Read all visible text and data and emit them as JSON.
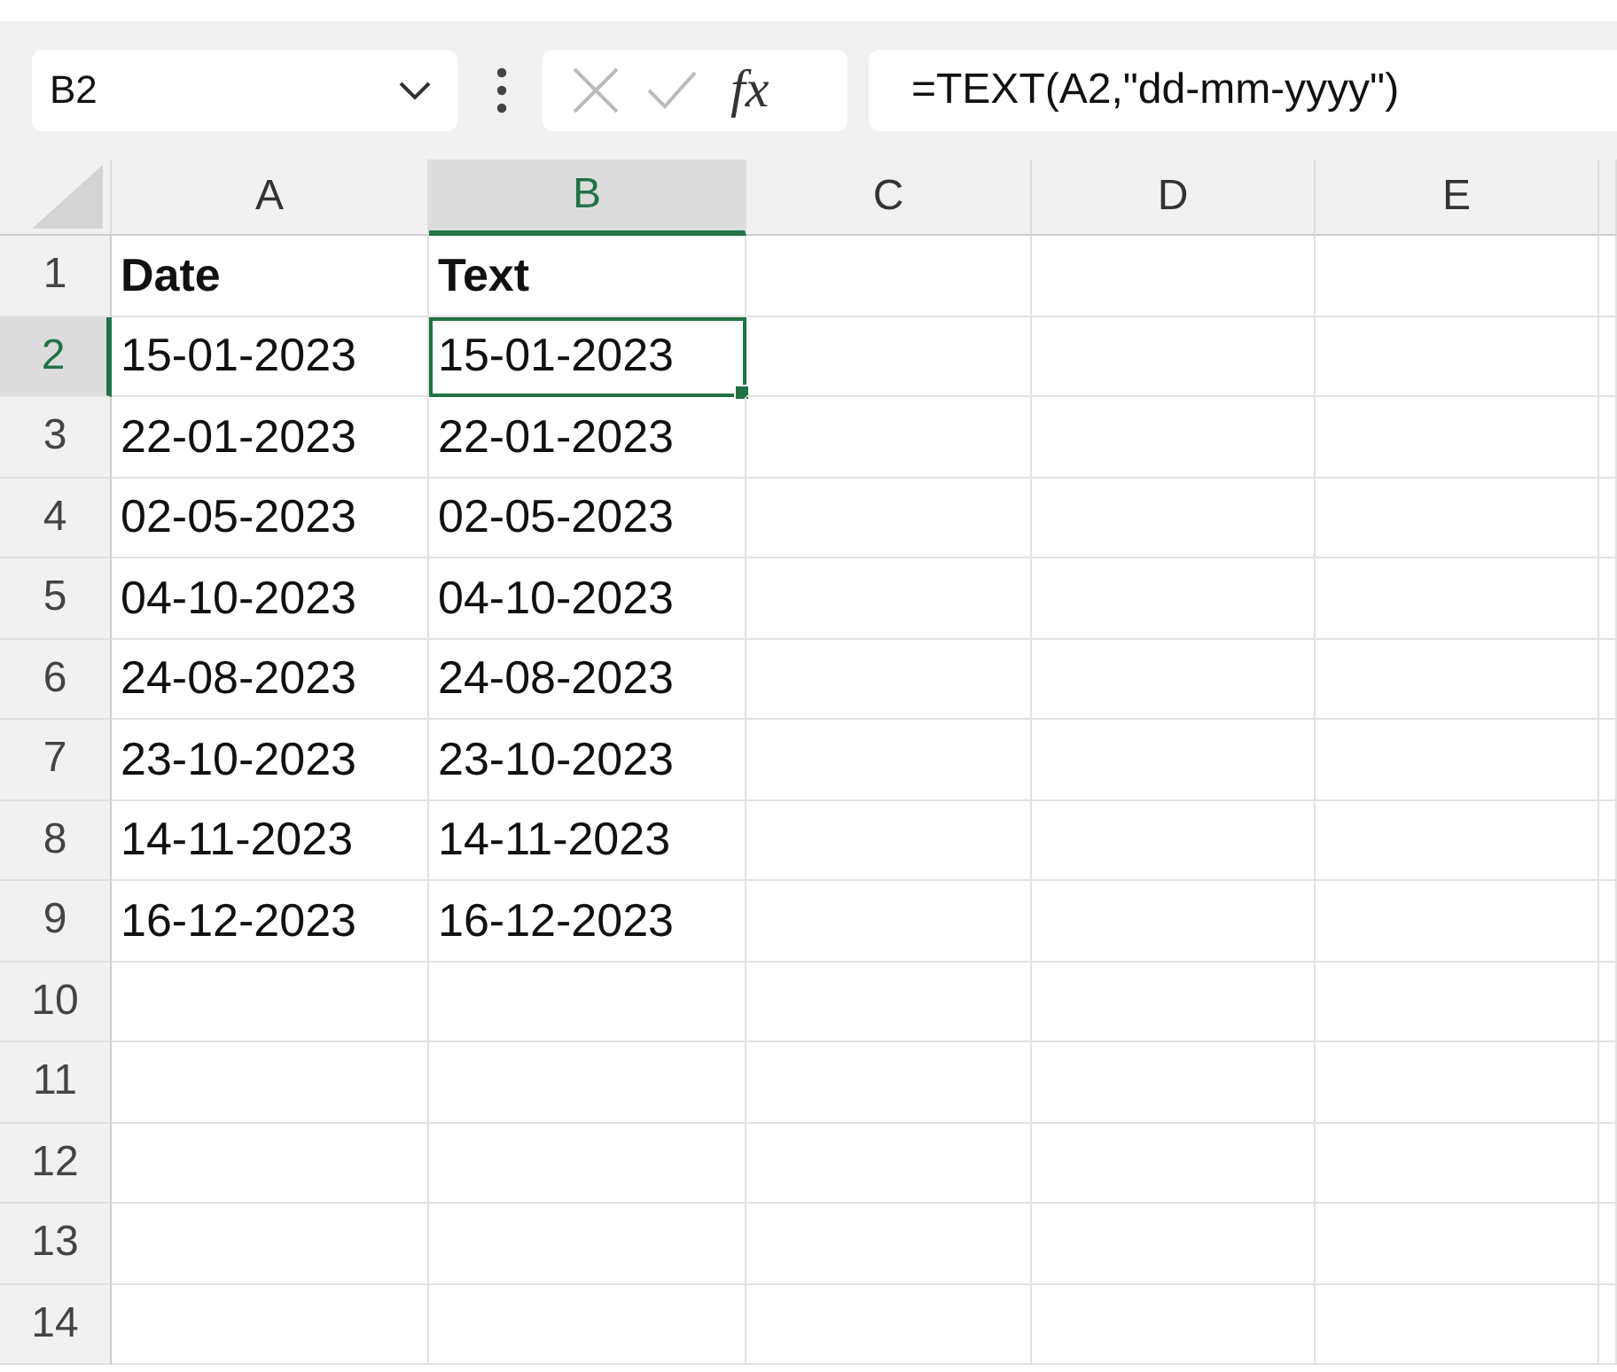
{
  "name_box": {
    "value": "B2"
  },
  "function_button": {
    "label": "fx"
  },
  "formula_bar": {
    "value": "=TEXT(A2,\"dd-mm-yyyy\")"
  },
  "columns": [
    {
      "label": "A",
      "selected": false
    },
    {
      "label": "B",
      "selected": true
    },
    {
      "label": "C",
      "selected": false
    },
    {
      "label": "D",
      "selected": false
    },
    {
      "label": "E",
      "selected": false
    }
  ],
  "rows": [
    {
      "number": "1",
      "selected": false,
      "kind": "header",
      "cells": [
        {
          "text": "Date",
          "selected": false
        },
        {
          "text": "Text",
          "selected": false
        }
      ]
    },
    {
      "number": "2",
      "selected": true,
      "kind": "data",
      "cells": [
        {
          "text": "15-01-2023",
          "selected": false
        },
        {
          "text": "15-01-2023",
          "selected": true
        }
      ]
    },
    {
      "number": "3",
      "selected": false,
      "kind": "data",
      "cells": [
        {
          "text": "22-01-2023",
          "selected": false
        },
        {
          "text": "22-01-2023",
          "selected": false
        }
      ]
    },
    {
      "number": "4",
      "selected": false,
      "kind": "data",
      "cells": [
        {
          "text": "02-05-2023",
          "selected": false
        },
        {
          "text": "02-05-2023",
          "selected": false
        }
      ]
    },
    {
      "number": "5",
      "selected": false,
      "kind": "data",
      "cells": [
        {
          "text": "04-10-2023",
          "selected": false
        },
        {
          "text": "04-10-2023",
          "selected": false
        }
      ]
    },
    {
      "number": "6",
      "selected": false,
      "kind": "data",
      "cells": [
        {
          "text": "24-08-2023",
          "selected": false
        },
        {
          "text": "24-08-2023",
          "selected": false
        }
      ]
    },
    {
      "number": "7",
      "selected": false,
      "kind": "data",
      "cells": [
        {
          "text": "23-10-2023",
          "selected": false
        },
        {
          "text": "23-10-2023",
          "selected": false
        }
      ]
    },
    {
      "number": "8",
      "selected": false,
      "kind": "data",
      "cells": [
        {
          "text": "14-11-2023",
          "selected": false
        },
        {
          "text": "14-11-2023",
          "selected": false
        }
      ]
    },
    {
      "number": "9",
      "selected": false,
      "kind": "data",
      "cells": [
        {
          "text": "16-12-2023",
          "selected": false
        },
        {
          "text": "16-12-2023",
          "selected": false
        }
      ]
    },
    {
      "number": "10",
      "selected": false,
      "kind": "data"
    },
    {
      "number": "11",
      "selected": false,
      "kind": "data"
    },
    {
      "number": "12",
      "selected": false,
      "kind": "data"
    },
    {
      "number": "13",
      "selected": false,
      "kind": "data"
    },
    {
      "number": "14",
      "selected": false,
      "kind": "data"
    }
  ]
}
